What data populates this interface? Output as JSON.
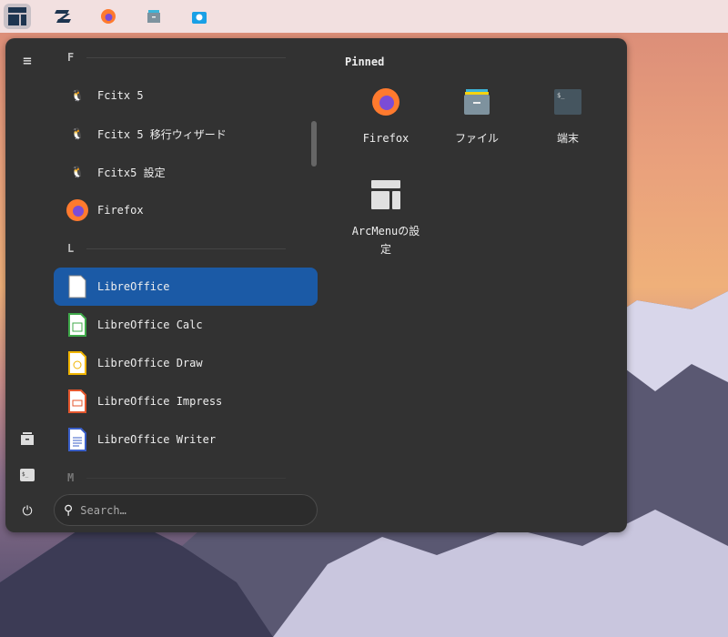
{
  "taskbar": {
    "icons": [
      "arcmenu-icon",
      "zorin-icon",
      "firefox-icon",
      "files-icon",
      "software-store-icon"
    ]
  },
  "sidebar": {
    "menu": "hamburger-icon",
    "bottom": [
      "files-icon",
      "terminal-icon",
      "power-icon"
    ]
  },
  "list": {
    "sections": [
      {
        "letter": "F"
      },
      {
        "letter": "L"
      },
      {
        "letter": "M"
      }
    ],
    "items": [
      {
        "label": "Fcitx 5",
        "icon": "tux-icon"
      },
      {
        "label": "Fcitx 5 移行ウィザード",
        "icon": "tux-icon"
      },
      {
        "label": "Fcitx5 設定",
        "icon": "tux-icon"
      },
      {
        "label": "Firefox",
        "icon": "firefox-icon"
      },
      {
        "label": "LibreOffice",
        "icon": "libreoffice-icon",
        "selected": true
      },
      {
        "label": "LibreOffice Calc",
        "icon": "calc-icon"
      },
      {
        "label": "LibreOffice Draw",
        "icon": "draw-icon"
      },
      {
        "label": "LibreOffice Impress",
        "icon": "impress-icon"
      },
      {
        "label": "LibreOffice Writer",
        "icon": "writer-icon"
      }
    ]
  },
  "search": {
    "placeholder": "Search…"
  },
  "pinned": {
    "title": "Pinned",
    "items": [
      {
        "label": "Firefox"
      },
      {
        "label": "ファイル"
      },
      {
        "label": "端末"
      },
      {
        "label": "ArcMenuの設定",
        "line1": "ArcMenuの設",
        "line2": "定"
      }
    ]
  },
  "colors": {
    "accent": "#1b5aa6",
    "panel": "#323232"
  }
}
